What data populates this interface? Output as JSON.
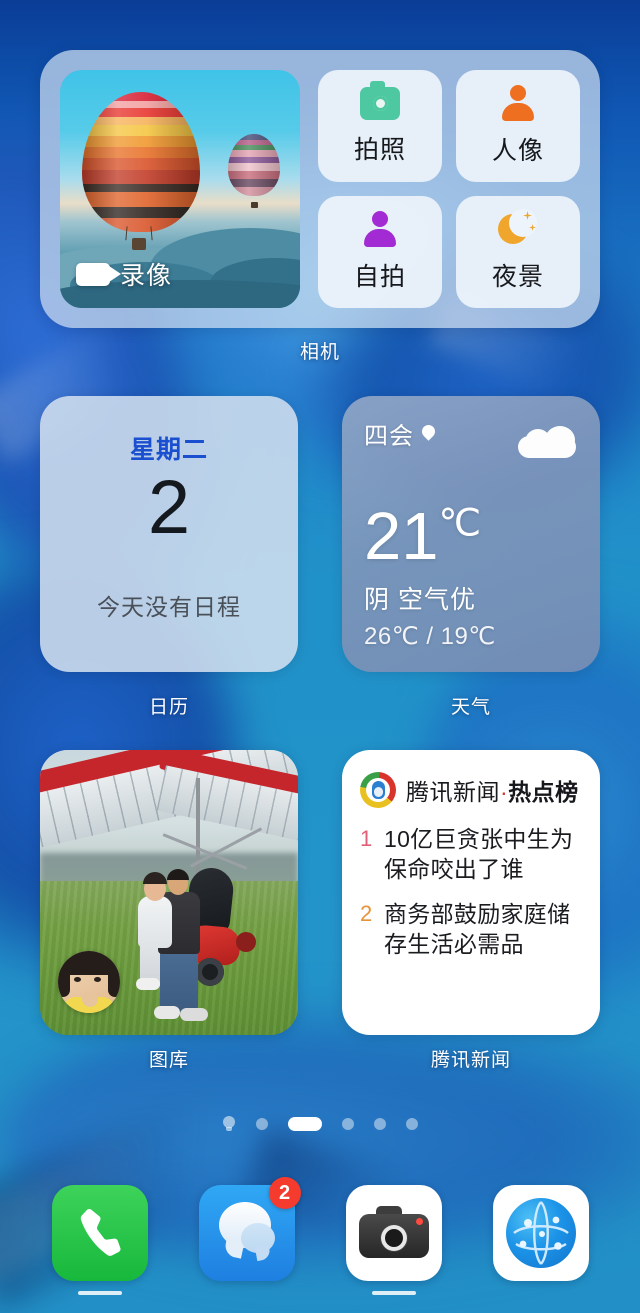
{
  "camera_widget": {
    "label": "相机",
    "video_shortcut": {
      "label": "录像",
      "icon": "video-camera-icon"
    },
    "tiles": [
      {
        "label": "拍照",
        "icon": "camera-icon",
        "color": "#4ec8a0"
      },
      {
        "label": "人像",
        "icon": "person-icon",
        "color": "#ef6f20"
      },
      {
        "label": "自拍",
        "icon": "person-icon",
        "color": "#a32bd4"
      },
      {
        "label": "夜景",
        "icon": "moon-stars-icon",
        "color": "#f0a62c"
      }
    ]
  },
  "calendar_widget": {
    "label": "日历",
    "weekday": "星期二",
    "date": "2",
    "note": "今天没有日程",
    "weekday_color": "#1a4fd0"
  },
  "weather_widget": {
    "label": "天气",
    "city": "四会",
    "location_icon": "location-pin-icon",
    "condition_icon": "cloud-icon",
    "temperature": "21",
    "unit": "℃",
    "condition": "阴 空气优",
    "range": "26℃ / 19℃"
  },
  "gallery_widget": {
    "label": "图库"
  },
  "news_widget": {
    "label": "腾讯新闻",
    "logo": "tencent-news-logo-icon",
    "title_main": "腾讯新闻",
    "title_sep": "·",
    "title_bold": "热点榜",
    "items": [
      {
        "rank": "1",
        "text": "10亿巨贪张中生为保命咬出了谁",
        "rank_color": "#e0607a"
      },
      {
        "rank": "2",
        "text": "商务部鼓励家庭储存生活必需品",
        "rank_color": "#e5943c"
      }
    ]
  },
  "page_indicator": {
    "total": 6,
    "active_index": 2,
    "first_icon": "smart-assistant-bulb-icon"
  },
  "dock": {
    "apps": [
      {
        "name": "phone",
        "icon": "phone-handset-icon",
        "badge": "",
        "color": "#17b83c"
      },
      {
        "name": "messages",
        "icon": "message-bubble-icon",
        "badge": "2",
        "color": "#1e7fe0"
      },
      {
        "name": "camera",
        "icon": "camera-icon",
        "badge": "",
        "color": "#262626"
      },
      {
        "name": "browser",
        "icon": "globe-icon",
        "badge": "",
        "color": "#1c94e8"
      }
    ]
  }
}
